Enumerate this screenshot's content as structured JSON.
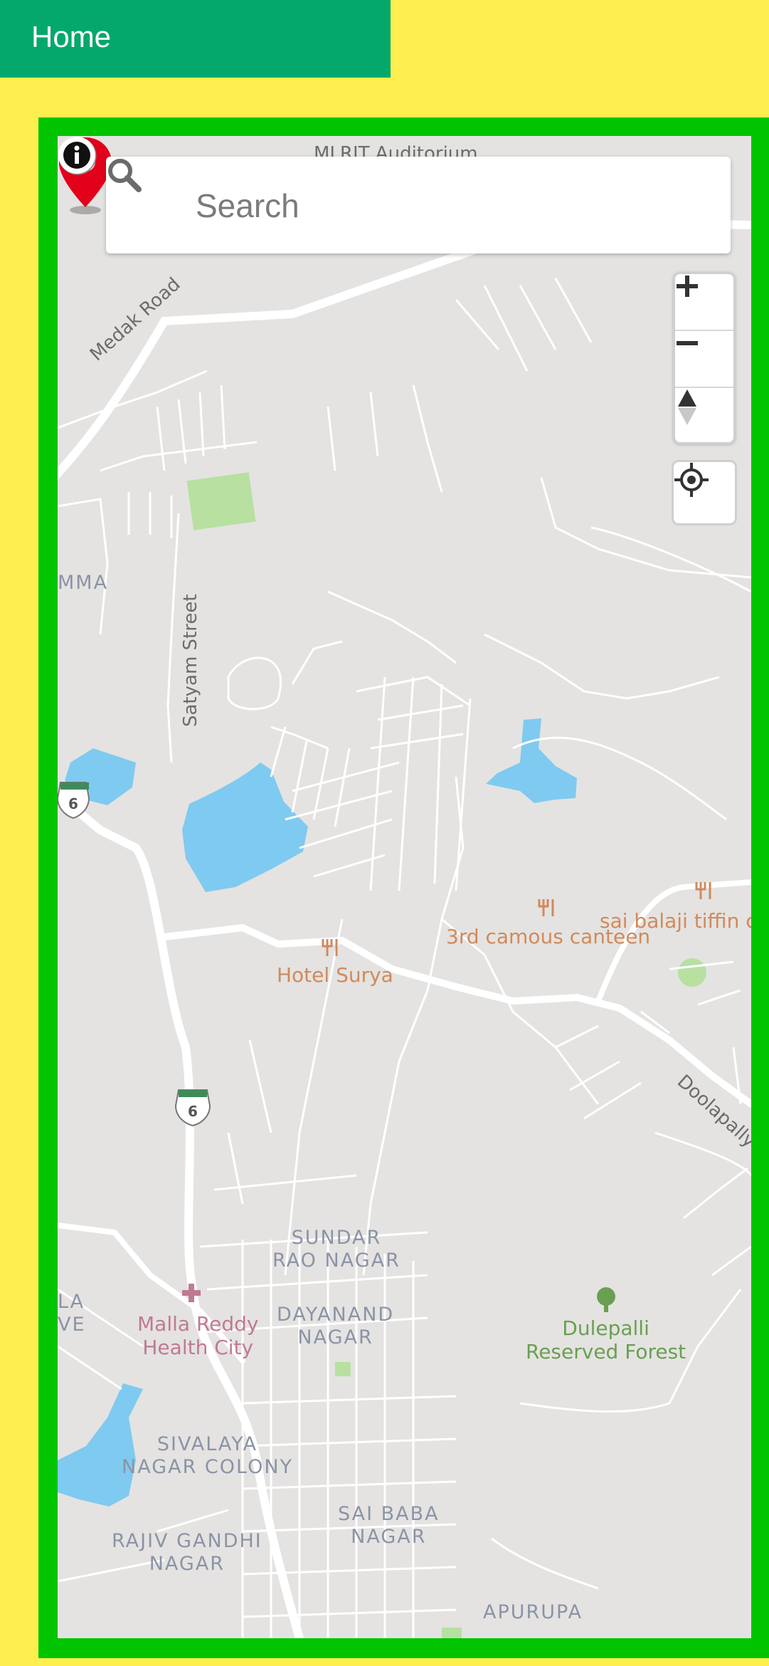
{
  "header": {
    "title": "Home"
  },
  "search": {
    "placeholder": "Search"
  },
  "map_controls": {
    "zoom_in_icon": "plus-icon",
    "zoom_out_icon": "minus-icon",
    "compass_icon": "north-arrow-icon",
    "locate_icon": "my-location-icon"
  },
  "map_labels": {
    "top_cut_label": "MLRIT Auditorium",
    "medak_road": "Medak Road",
    "mma_fragment": "MMA",
    "satyam_street": "Satyam Street",
    "highway_shield_1": "6",
    "highway_shield_2": "6",
    "hotel_surya": "Hotel Surya",
    "camous_canteen": "3rd camous canteen",
    "sai_balaji": "sai balaji tiffin c",
    "doolapally": "Doolapally",
    "sundar_rao_nagar_1": "SUNDAR",
    "sundar_rao_nagar_2": "RAO NAGAR",
    "dayanand_nagar_1": "DAYANAND",
    "dayanand_nagar_2": "NAGAR",
    "malla_reddy_1": "Malla Reddy",
    "malla_reddy_2": "Health City",
    "la_fragment": "LA",
    "ve_fragment": "VE",
    "dulepalli_1": "Dulepalli",
    "dulepalli_2": "Reserved Forest",
    "sivalaya_1": "SIVALAYA",
    "sivalaya_2": "NAGAR COLONY",
    "sai_baba_1": "SAI BABA",
    "sai_baba_2": "NAGAR",
    "rajiv_gandhi_1": "RAJIV GANDHI",
    "rajiv_gandhi_2": "NAGAR",
    "apurupa": "APURUPA"
  },
  "colors": {
    "topbar": "#04a86b",
    "page_background": "#ffee4f",
    "frame_border": "#00c400",
    "map_land": "#e4e3e1",
    "water": "#7fcaf0",
    "park": "#b7e0a1",
    "pin": "#e2001a"
  }
}
